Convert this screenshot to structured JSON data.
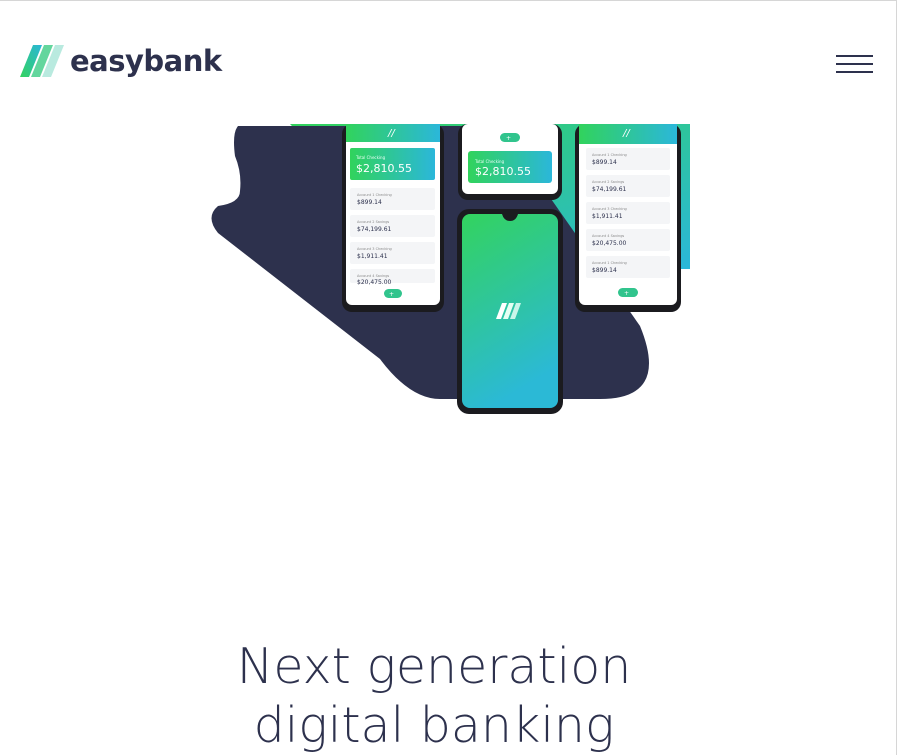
{
  "header": {
    "brand": "easybank",
    "logo_icon": "easybank-stripes-logo",
    "menu_icon": "hamburger-menu-icon"
  },
  "hero": {
    "headline_line1": "Next generation",
    "headline_line2": "digital banking",
    "phones": {
      "left": {
        "balance_label": "Total Checking",
        "balance": "$2,810.55",
        "accounts": [
          {
            "name": "Account 1 Checking",
            "amount": "$899.14"
          },
          {
            "name": "Account 2 Savings",
            "amount": "$74,199.61"
          },
          {
            "name": "Account 3 Checking",
            "amount": "$1,911.41"
          },
          {
            "name": "Account 4 Savings",
            "amount": "$20,475.00"
          }
        ]
      },
      "middle": {
        "balance_label": "Total Checking",
        "balance": "$2,810.55"
      },
      "right": {
        "accounts": [
          {
            "name": "Account 1 Checking",
            "amount": "$899.14"
          },
          {
            "name": "Account 2 Savings",
            "amount": "$74,199.61"
          },
          {
            "name": "Account 3 Checking",
            "amount": "$1,911.41"
          },
          {
            "name": "Account 4 Savings",
            "amount": "$20,475.00"
          },
          {
            "name": "Account 1 Checking",
            "amount": "$899.14"
          }
        ]
      }
    }
  },
  "colors": {
    "dark_blue": "#2d314d",
    "lime_green": "#31d35c",
    "bright_cyan": "#2bb7da",
    "white": "#ffffff"
  }
}
